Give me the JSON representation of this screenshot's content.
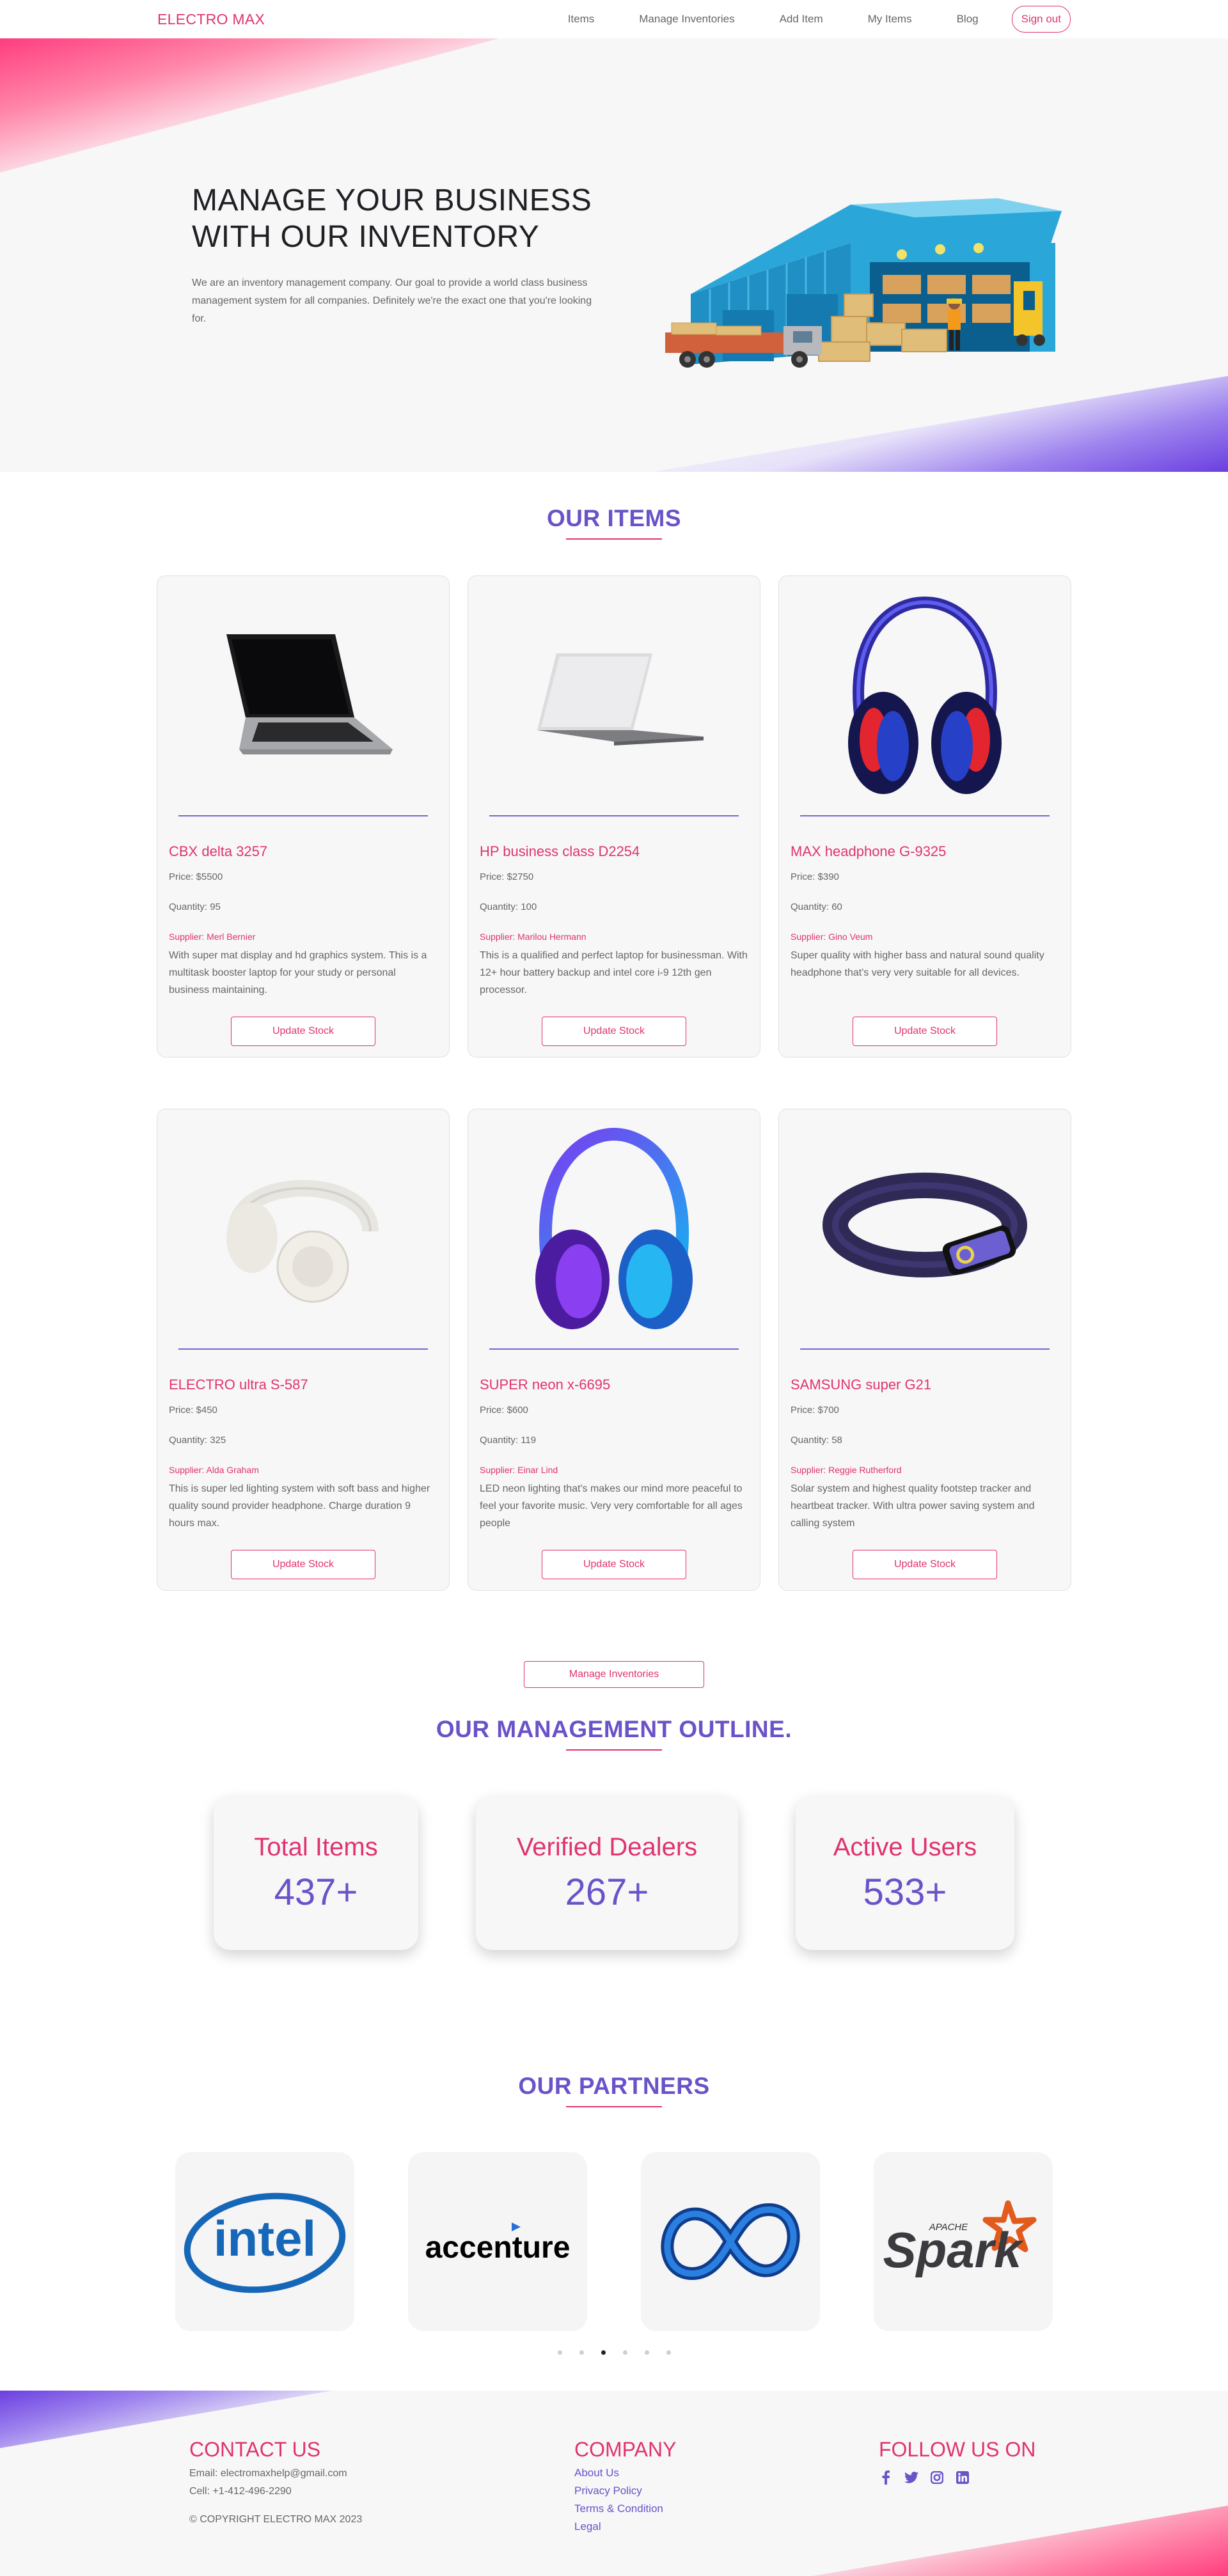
{
  "nav": {
    "brand": "ELECTRO MAX",
    "links": [
      "Items",
      "Manage Inventories",
      "Add Item",
      "My Items",
      "Blog"
    ],
    "signout": "Sign out"
  },
  "hero": {
    "title": "MANAGE YOUR BUSINESS WITH OUR INVENTORY",
    "description": "We are an inventory management company. Our goal to provide a world class business management system for all companies. Definitely we're the exact one that you're looking for."
  },
  "items_section": {
    "title": "OUR ITEMS",
    "update_label": "Update Stock",
    "items": [
      {
        "name": "CBX delta 3257",
        "price": "Price: $5500",
        "quantity": "Quantity: 95",
        "supplier": "Supplier: Merl Bernier",
        "description": "With super mat display and hd graphics system. This is a multitask booster laptop for your study or personal business maintaining."
      },
      {
        "name": "HP business class D2254",
        "price": "Price: $2750",
        "quantity": "Quantity: 100",
        "supplier": "Supplier: Marilou Hermann",
        "description": "This is a qualified and perfect laptop for businessman. With 12+ hour battery backup and intel core i-9 12th gen processor."
      },
      {
        "name": "MAX headphone G-9325",
        "price": "Price: $390",
        "quantity": "Quantity: 60",
        "supplier": "Supplier: Gino Veum",
        "description": "Super quality with higher bass and natural sound quality headphone that's very very suitable for all devices."
      },
      {
        "name": "ELECTRO ultra S-587",
        "price": "Price: $450",
        "quantity": "Quantity: 325",
        "supplier": "Supplier: Alda Graham",
        "description": "This is super led lighting system with soft bass and higher quality sound provider headphone. Charge duration 9 hours max."
      },
      {
        "name": "SUPER neon x-6695",
        "price": "Price: $600",
        "quantity": "Quantity: 119",
        "supplier": "Supplier: Einar Lind",
        "description": "LED neon lighting that's makes our mind more peaceful to feel your favorite music. Very very comfortable for all ages people"
      },
      {
        "name": "SAMSUNG super G21",
        "price": "Price: $700",
        "quantity": "Quantity: 58",
        "supplier": "Supplier: Reggie Rutherford",
        "description": "Solar system and highest quality footstep tracker and heartbeat tracker. With ultra power saving system and calling system"
      }
    ]
  },
  "manage": {
    "button": "Manage Inventories",
    "title": "OUR MANAGEMENT OUTLINE.",
    "stats": [
      {
        "label": "Total Items",
        "value": "437+"
      },
      {
        "label": "Verified Dealers",
        "value": "267+"
      },
      {
        "label": "Active Users",
        "value": "533+"
      }
    ]
  },
  "partners": {
    "title": "OUR PARTNERS",
    "logos": [
      "intel",
      "accenture",
      "meta",
      "Spark"
    ],
    "spark_apache": "APACHE",
    "active_dot": 2
  },
  "footer": {
    "contact_title": "CONTACT US",
    "email": "Email: electromaxhelp@gmail.com",
    "cell": "Cell: +1-412-496-2290",
    "copyright": "© COPYRIGHT ELECTRO MAX 2023",
    "company_title": "COMPANY",
    "company_links": [
      "About Us",
      "Privacy Policy",
      "Terms & Condition",
      "Legal"
    ],
    "follow_title": "FOLLOW US ON",
    "social_icons": [
      "facebook-icon",
      "twitter-icon",
      "instagram-icon",
      "linkedin-icon"
    ]
  },
  "colors": {
    "accent_pink": "#e0336f",
    "accent_purple": "#6a52c8",
    "page_gray": "#f7f7f8"
  }
}
